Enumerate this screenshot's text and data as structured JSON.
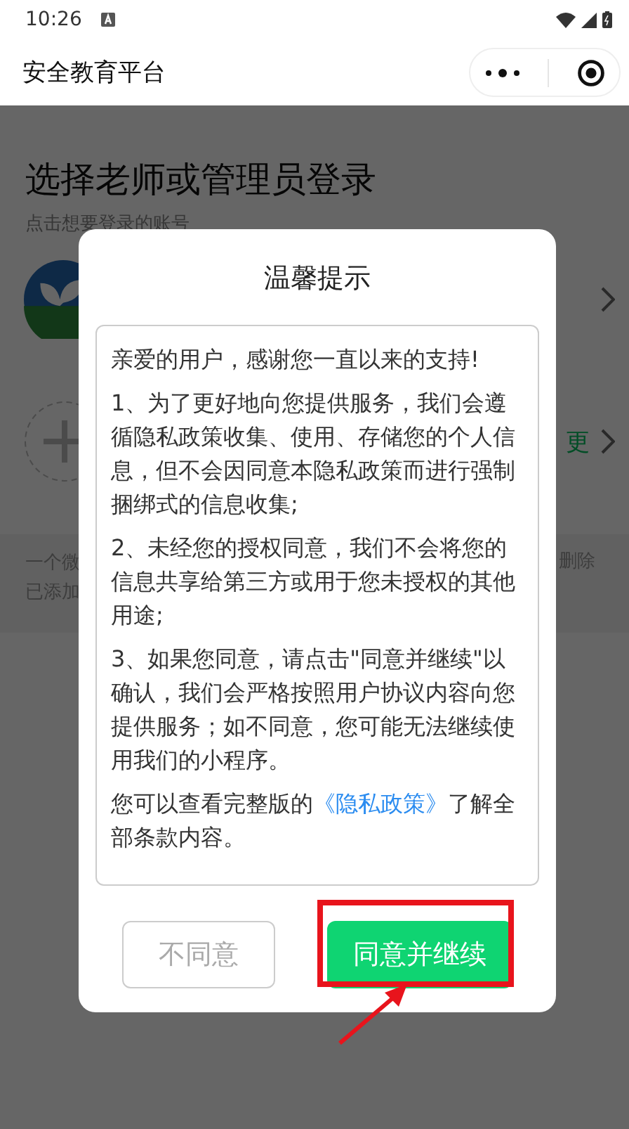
{
  "status_bar": {
    "time": "10:26"
  },
  "nav_bar": {
    "title": "安全教育平台"
  },
  "page": {
    "title": "选择老师或管理员登录",
    "subtitle": "点击想要登录的账号",
    "right_fragment": "更",
    "footer_left": [
      "一个微",
      "已添加"
    ],
    "footer_right": "删除"
  },
  "dialog": {
    "title": "温馨提示",
    "paragraphs": [
      "亲爱的用户，感谢您一直以来的支持!",
      "1、为了更好地向您提供服务，我们会遵循隐私政策收集、使用、存储您的个人信息，但不会因同意本隐私政策而进行强制捆绑式的信息收集;",
      "2、未经您的授权同意，我们不会将您的信息共享给第三方或用于您未授权的其他用途;",
      "3、如果您同意，请点击\"同意并继续\"以确认，我们会严格按照用户协议内容向您提供服务；如不同意，您可能无法继续使用我们的小程序。"
    ],
    "closing": {
      "before": "您可以查看完整版的",
      "link": "《隐私政策》",
      "after": "了解全部条款内容。"
    },
    "buttons": [
      {
        "label": "不同意",
        "kind": "secondary"
      },
      {
        "label": "同意并继续",
        "kind": "primary"
      }
    ]
  }
}
